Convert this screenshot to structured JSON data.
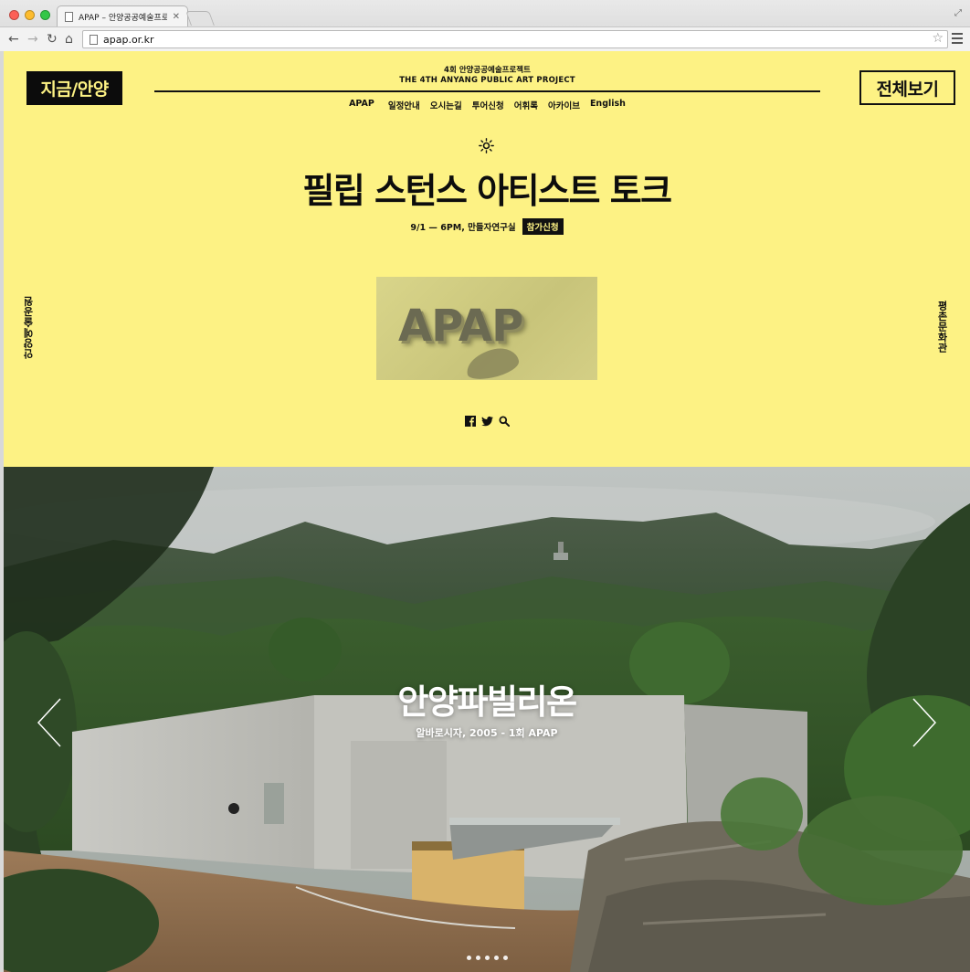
{
  "browser": {
    "tab_title": "APAP – 안양공공예술프로젝트",
    "url": "apap.or.kr"
  },
  "header": {
    "logo": "지금/안양",
    "view_all": "전체보기",
    "project_ko": "4회 안양공공예술프로젝트",
    "project_en": "THE 4TH ANYANG PUBLIC ART PROJECT",
    "nav": [
      "APAP",
      "일정안내",
      "오시는길",
      "투어신청",
      "어휘록",
      "아카이브",
      "English"
    ]
  },
  "event": {
    "title": "필립 스턴스 아티스트 토크",
    "meta": "9/1 — 6PM, 만들자연구실",
    "apply": "참가신청",
    "image_text": "APAP"
  },
  "side": {
    "left": "안양예술공원",
    "right": "평촌문화관"
  },
  "slide": {
    "title": "안양파빌리온",
    "caption": "알바로시자, 2005 - 1회 APAP",
    "dot_count": 5
  }
}
